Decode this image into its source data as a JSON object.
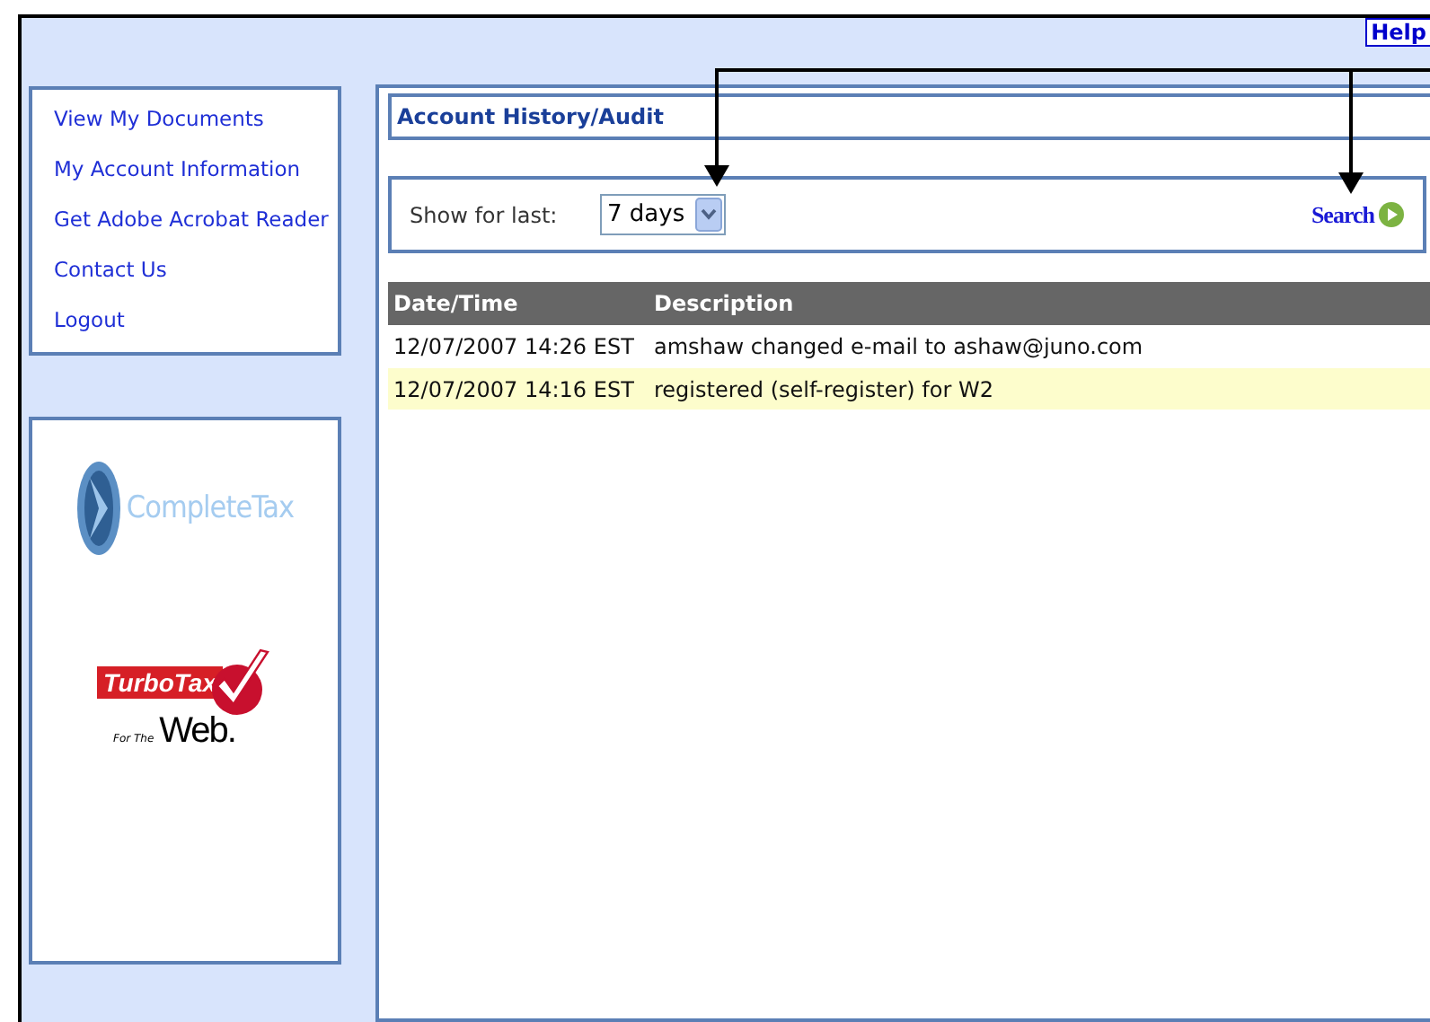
{
  "header": {
    "help_link": "Help"
  },
  "sidebar": {
    "items": [
      {
        "label": "View My Documents"
      },
      {
        "label": "My Account Information"
      },
      {
        "label": "Get Adobe Acrobat Reader"
      },
      {
        "label": "Contact Us"
      },
      {
        "label": "Logout"
      }
    ],
    "logos": [
      {
        "kind": "completetax",
        "text": "CompleteTax"
      },
      {
        "kind": "turbotax",
        "text": "TurboTax",
        "subtitle_small": "For The",
        "subtitle": "Web."
      }
    ]
  },
  "panel": {
    "title": "Account History/Audit",
    "filter": {
      "label": "Show for last:",
      "value": "7 days",
      "search": "Search"
    },
    "table": {
      "columns": [
        "Date/Time",
        "Description"
      ],
      "rows": [
        {
          "cells": [
            "12/07/2007 14:26 EST",
            "amshaw changed e-mail to ashaw@juno.com"
          ],
          "highlighted": false
        },
        {
          "cells": [
            "12/07/2007 14:16 EST",
            "registered (self-register) for W2"
          ],
          "highlighted": true
        }
      ]
    }
  }
}
